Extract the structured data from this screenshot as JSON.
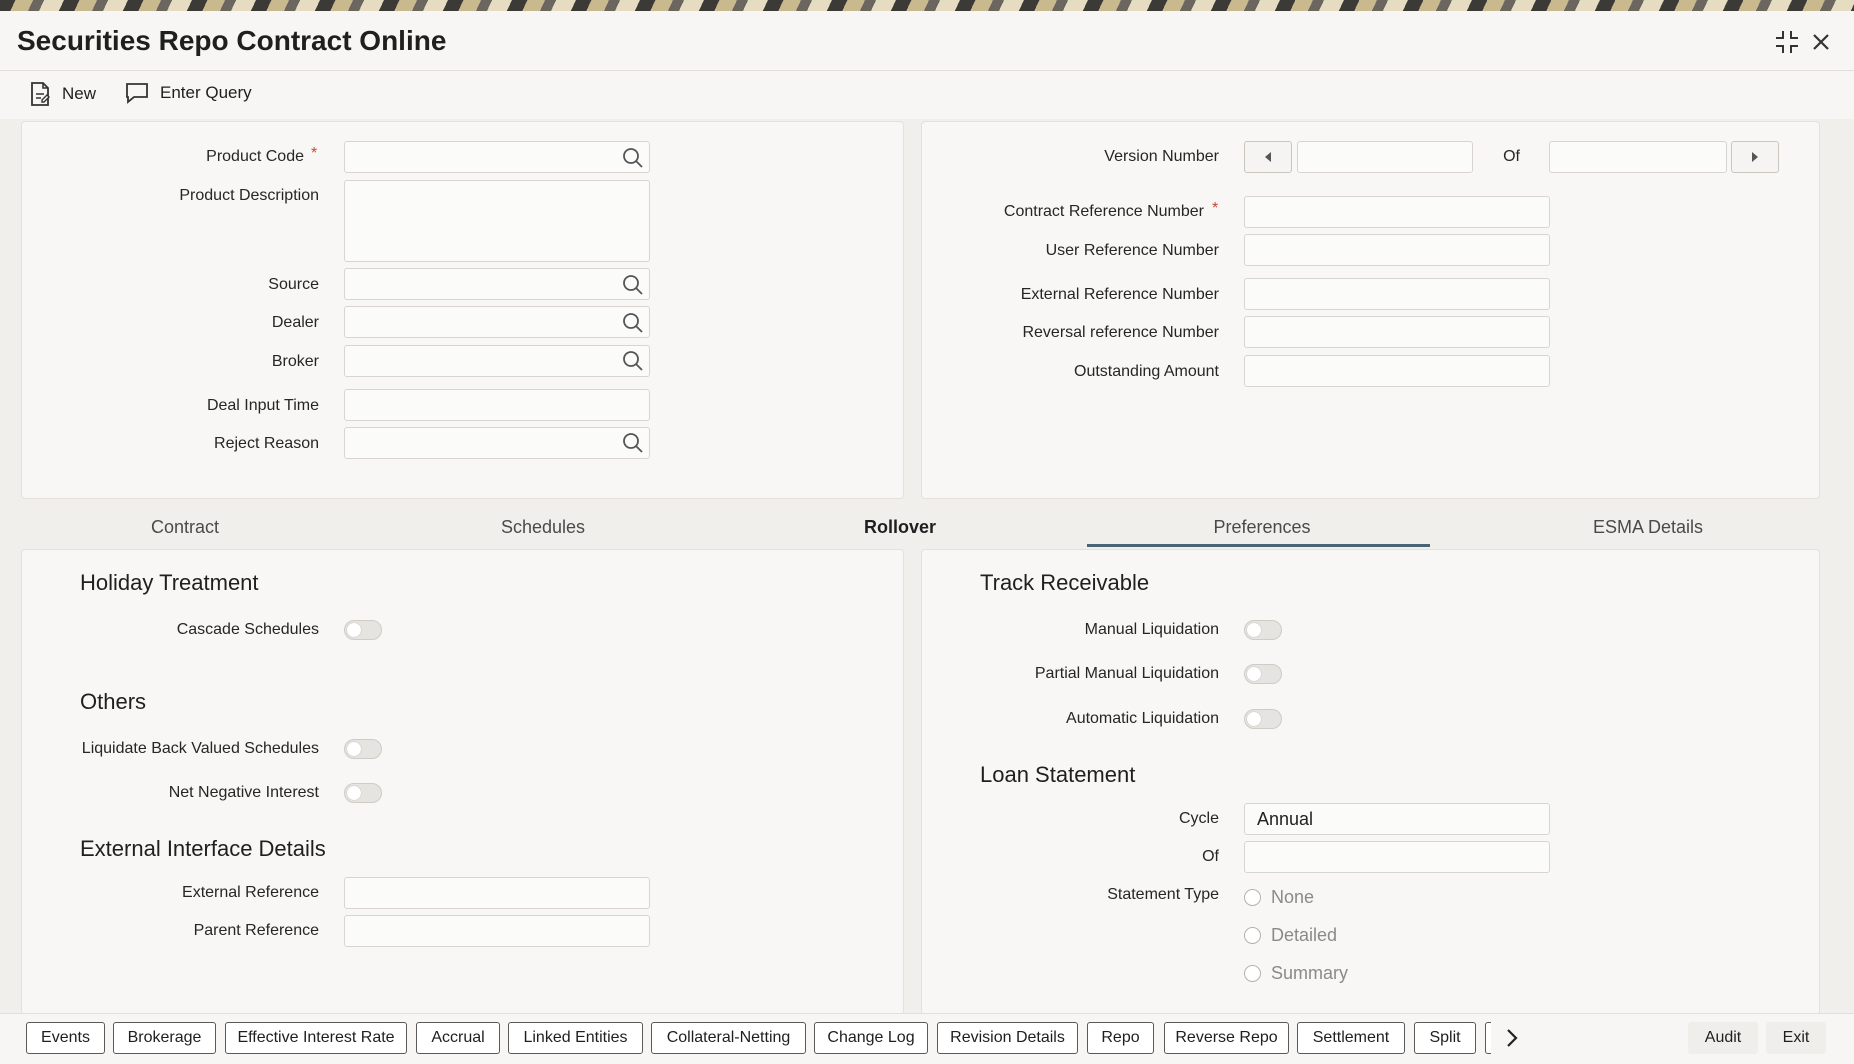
{
  "window": {
    "title": "Securities Repo Contract Online"
  },
  "toolbar": {
    "new_label": "New",
    "enter_query_label": "Enter Query"
  },
  "header_left": {
    "product_code_label": "Product Code",
    "product_description_label": "Product Description",
    "source_label": "Source",
    "dealer_label": "Dealer",
    "broker_label": "Broker",
    "deal_input_time_label": "Deal Input Time",
    "reject_reason_label": "Reject Reason",
    "required_marker": "*"
  },
  "header_right": {
    "version_number_label": "Version Number",
    "of_label": "Of",
    "contract_reference_label": "Contract Reference Number",
    "user_reference_label": "User Reference Number",
    "external_reference_label": "External Reference Number",
    "reversal_reference_label": "Reversal reference Number",
    "outstanding_amount_label": "Outstanding Amount"
  },
  "tabs": [
    {
      "label": "Contract"
    },
    {
      "label": "Schedules"
    },
    {
      "label": "Rollover"
    },
    {
      "label": "Preferences"
    },
    {
      "label": "ESMA Details"
    }
  ],
  "active_tab": "Preferences",
  "left_section": {
    "holiday_treatment_heading": "Holiday Treatment",
    "cascade_schedules_label": "Cascade Schedules",
    "others_heading": "Others",
    "liquidate_back_valued_label": "Liquidate Back Valued Schedules",
    "net_negative_interest_label": "Net Negative Interest",
    "external_interface_heading": "External Interface Details",
    "external_reference_label": "External Reference",
    "parent_reference_label": "Parent Reference"
  },
  "right_section": {
    "track_receivable_heading": "Track Receivable",
    "manual_liquidation_label": "Manual Liquidation",
    "partial_manual_liquidation_label": "Partial Manual Liquidation",
    "automatic_liquidation_label": "Automatic Liquidation",
    "loan_statement_heading": "Loan Statement",
    "cycle_label": "Cycle",
    "cycle_value": "Annual",
    "of_label": "Of",
    "statement_type_label": "Statement Type",
    "statement_options": [
      "None",
      "Detailed",
      "Summary"
    ]
  },
  "footer": {
    "buttons": [
      "Events",
      "Brokerage",
      "Effective Interest Rate",
      "Accrual",
      "Linked Entities",
      "Collateral-Netting",
      "Change Log",
      "Revision Details",
      "Repo",
      "Reverse Repo",
      "Settlement",
      "Split"
    ],
    "audit_label": "Audit",
    "exit_label": "Exit"
  },
  "colors": {
    "accent_underline": "#4b6474",
    "required": "#c74634"
  }
}
